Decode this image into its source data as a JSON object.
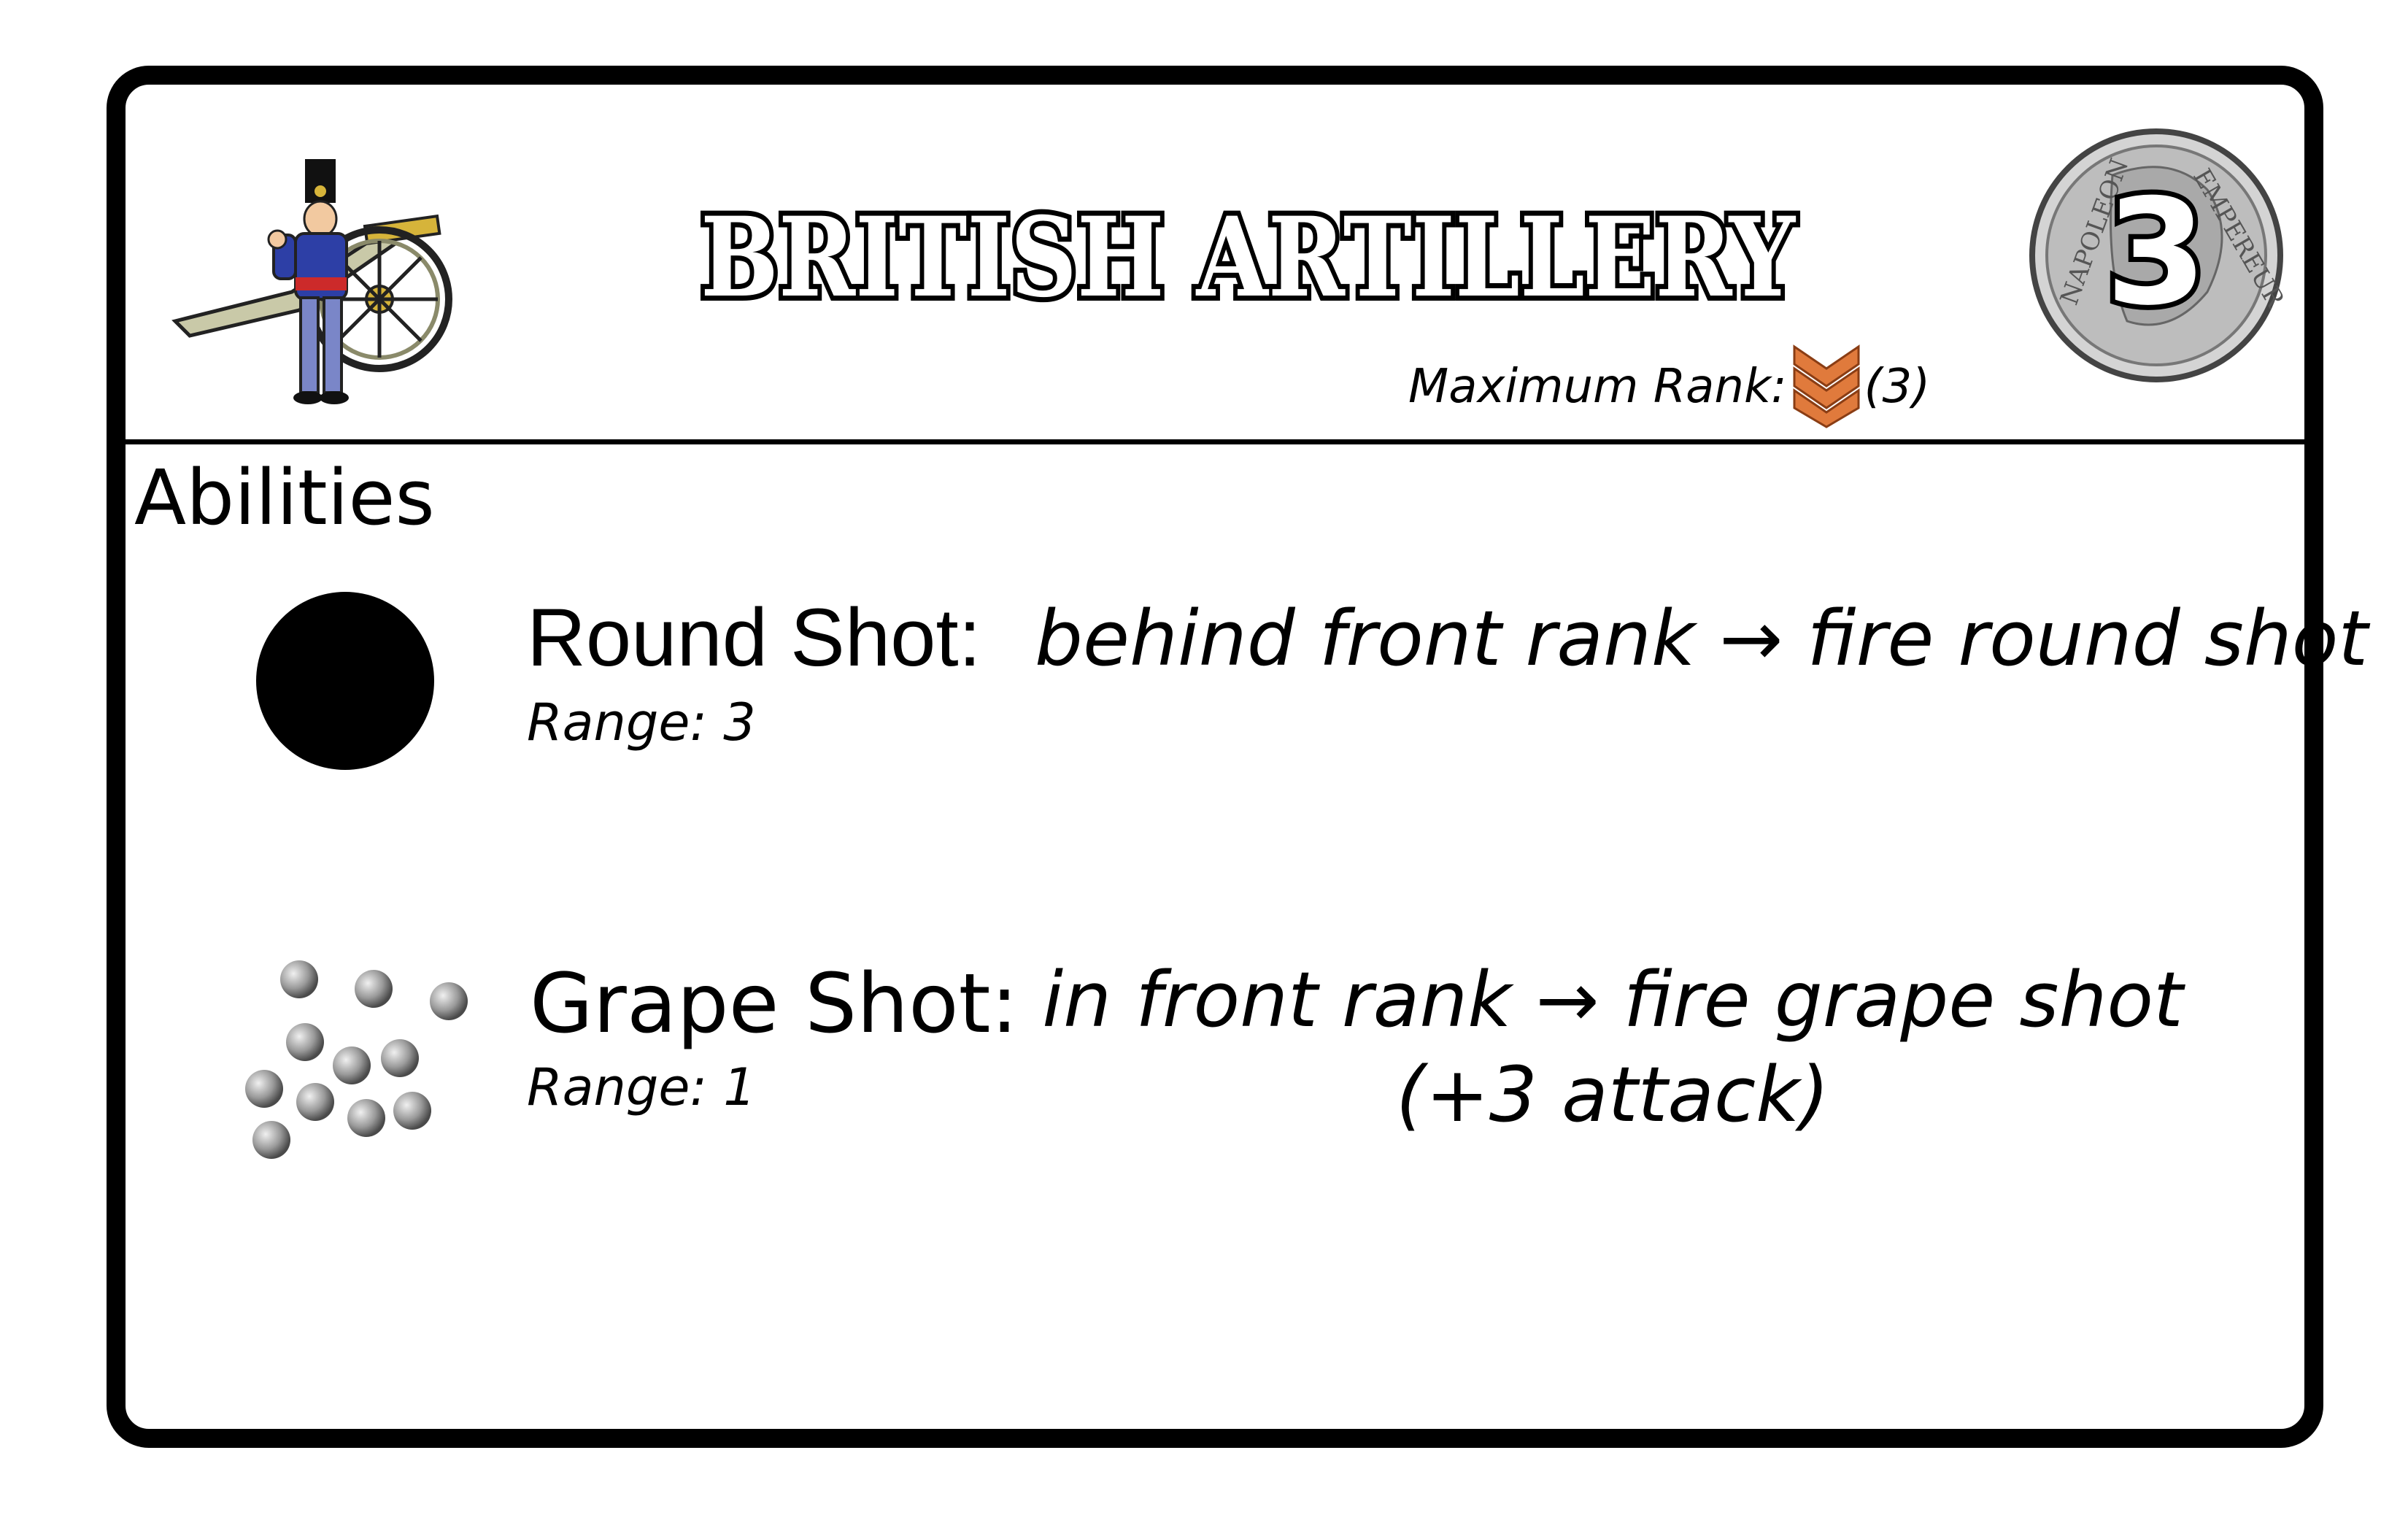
{
  "card": {
    "title": "BRITISH ARTILLERY",
    "cost": "3",
    "max_rank_label": "Maximum Rank:",
    "max_rank_value": "(3)",
    "rank_icon": "sergeant-chevron-icon",
    "portrait_icon": "artillery-soldier-cannon-icon",
    "coin_icon": "napoleon-coin-icon",
    "coin_legend_left": "NAPOLEON",
    "coin_legend_right": "EMPEREUR"
  },
  "abilities": {
    "heading": "Abilities",
    "items": [
      {
        "name": "Round Shot:",
        "range": "Range: 3",
        "effect_line1": "behind front rank → fire round shot",
        "effect_line2": "",
        "icon": "round-shot-icon"
      },
      {
        "name": "Grape Shot:",
        "range": "Range: 1",
        "effect_line1": "in front rank → fire grape shot",
        "effect_line2": "(+3 attack)",
        "icon": "grape-shot-icon"
      }
    ]
  },
  "colors": {
    "border": "#000000",
    "rank_chevron": "#e07a3c",
    "coin_silver": "#bdbdbd",
    "uniform_blue": "#2d3fa6",
    "cannon_brass": "#d6b43a"
  }
}
